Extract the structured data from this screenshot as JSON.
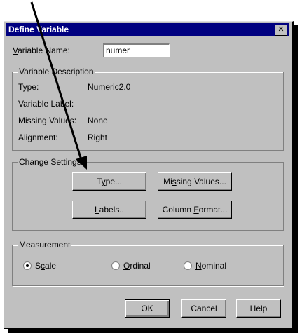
{
  "dialog": {
    "title": "Define Variable",
    "close_glyph": "✕",
    "variable_name": {
      "label_pre": "",
      "label_u": "V",
      "label_post": "ariable Name:",
      "value": "numer"
    },
    "description": {
      "legend": "Variable Description",
      "rows": [
        {
          "key": "Type:",
          "value": "Numeric2.0"
        },
        {
          "key": "Variable Label:",
          "value": ""
        },
        {
          "key": "Missing Values:",
          "value": "None"
        },
        {
          "key": "Alignment:",
          "value": "Right"
        }
      ]
    },
    "change_settings": {
      "legend": "Change Settings",
      "type_button": {
        "pre": "T",
        "u": "y",
        "post": "pe..."
      },
      "missing_button": {
        "pre": "Mi",
        "u": "s",
        "post": "sing Values..."
      },
      "labels_button": {
        "pre": "",
        "u": "L",
        "post": "abels.."
      },
      "format_button": {
        "pre": "Column ",
        "u": "F",
        "post": "ormat..."
      }
    },
    "measurement": {
      "legend": "Measurement",
      "options": [
        {
          "pre": "S",
          "u": "c",
          "post": "ale",
          "checked": true
        },
        {
          "pre": "",
          "u": "O",
          "post": "rdinal",
          "checked": false
        },
        {
          "pre": "",
          "u": "N",
          "post": "ominal",
          "checked": false
        }
      ]
    },
    "buttons": {
      "ok": "OK",
      "cancel": "Cancel",
      "help": "Help"
    }
  },
  "colors": {
    "titlebar": "#000080",
    "face": "#c0c0c0",
    "arrow": "#000000"
  }
}
